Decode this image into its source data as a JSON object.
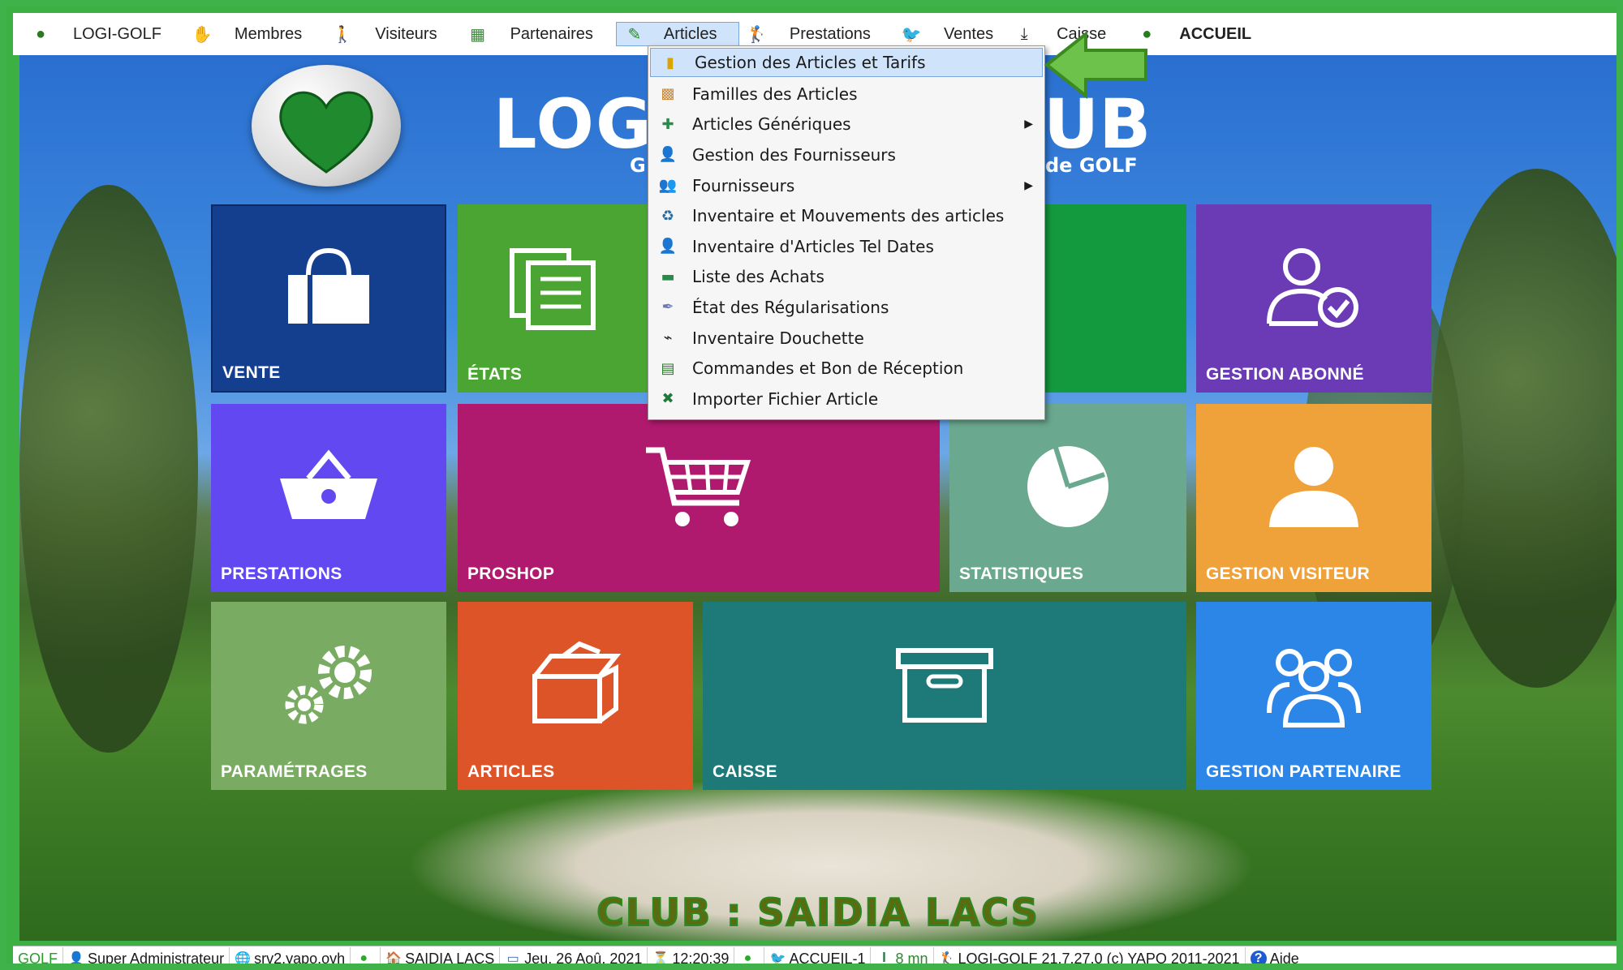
{
  "menubar": {
    "items": [
      {
        "label": "LOGI-GOLF",
        "icon": "golf-ball-icon"
      },
      {
        "label": "Membres",
        "icon": "members-icon"
      },
      {
        "label": "Visiteurs",
        "icon": "walker-icon"
      },
      {
        "label": "Partenaires",
        "icon": "map-icon"
      },
      {
        "label": "Articles",
        "icon": "pencil-icon"
      },
      {
        "label": "Prestations",
        "icon": "golfer-icon"
      },
      {
        "label": "Ventes",
        "icon": "bird-icon"
      },
      {
        "label": "Caisse",
        "icon": "download-icon"
      },
      {
        "label": "ACCUEIL",
        "icon": "golf-ball-icon"
      }
    ]
  },
  "dropdown": {
    "items": [
      {
        "label": "Gestion des Articles et Tarifs",
        "icon": "jar-icon",
        "highlighted": true
      },
      {
        "label": "Familles des Articles",
        "icon": "box-icon"
      },
      {
        "label": "Articles Génériques",
        "icon": "tools-icon",
        "submenu": true
      },
      {
        "label": "Gestion des Fournisseurs",
        "icon": "supplier-icon"
      },
      {
        "label": "Fournisseurs",
        "icon": "suppliers-icon",
        "submenu": true
      },
      {
        "label": "Inventaire et Mouvements des articles",
        "icon": "cycle-icon"
      },
      {
        "label": "Inventaire d'Articles Tel Dates",
        "icon": "person-icon"
      },
      {
        "label": "Liste des Achats",
        "icon": "money-icon"
      },
      {
        "label": "État des Régularisations",
        "icon": "pen-icon"
      },
      {
        "label": "Inventaire Douchette",
        "icon": "scanner-icon"
      },
      {
        "label": "Commandes et Bon de Réception",
        "icon": "book-icon"
      },
      {
        "label": "Importer Fichier Article",
        "icon": "excel-icon"
      }
    ]
  },
  "logo": {
    "title_left": "LOG",
    "title_right": "UB",
    "sub_left": "G",
    "sub_right": "de GOLF"
  },
  "tiles": {
    "vente": "VENTE",
    "etats": "ÉTATS",
    "abonne": "GESTION ABONNÉ",
    "prestations": "PRESTATIONS",
    "proshop": "PROSHOP",
    "statistiques": "STATISTIQUES",
    "visiteur": "GESTION VISITEUR",
    "parametrages": "PARAMÉTRAGES",
    "articles": "ARTICLES",
    "caisse": "CAISSE",
    "partenaire": "GESTION PARTENAIRE"
  },
  "club": "CLUB : SAIDIA LACS",
  "footer": {
    "app": "GOLF",
    "user": "Super Administrateur",
    "server": "srv2.yapo.ovh",
    "club": "SAIDIA LACS",
    "date": "Jeu. 26 Aoû. 2021",
    "time": "12:20:39",
    "station": "ACCUEIL-1",
    "duration": "8 mn",
    "version": "LOGI-GOLF 21.7.27.0  (c) YAPO 2011-2021",
    "help": "Aide"
  },
  "colors": {
    "vente": "#143f8f",
    "etats": "#4aa532",
    "green_tile": "#149a3e",
    "abonne": "#6a3bb5",
    "prestations": "#6248f0",
    "proshop": "#b01a6e",
    "statistiques": "#6aa88f",
    "visiteur": "#efa23a",
    "parametrages": "#7aab62",
    "articles": "#dd5428",
    "caisse": "#1d7a78",
    "partenaire": "#2c86e8"
  }
}
